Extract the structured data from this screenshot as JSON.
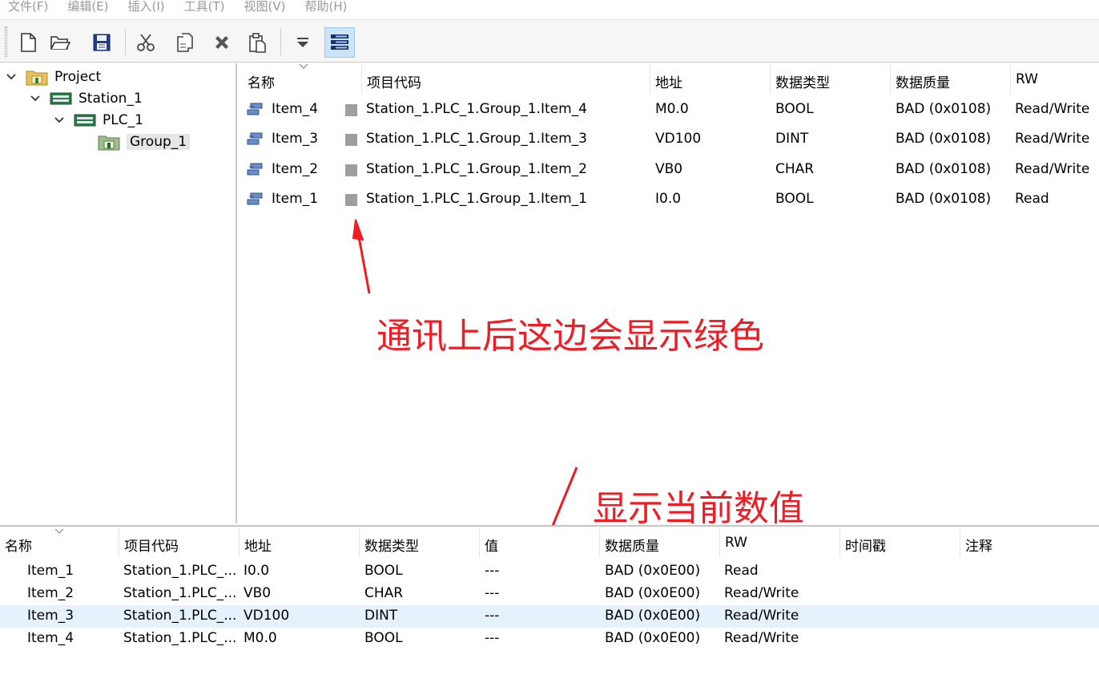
{
  "menu": [
    "文件(F)",
    "编辑(E)",
    "插入(I)",
    "工具(T)",
    "视图(V)",
    "帮助(H)"
  ],
  "toolbar": {
    "buttons": [
      "new-file-icon",
      "open-folder-icon",
      "save-icon",
      "cut-icon",
      "copy-icon",
      "delete-icon",
      "paste-icon",
      "filter-icon",
      "monitor-view-icon"
    ]
  },
  "tree": {
    "project": "Project",
    "station": "Station_1",
    "plc": "PLC_1",
    "group": "Group_1"
  },
  "item_list": {
    "columns": [
      "名称",
      "项目代码",
      "地址",
      "数据类型",
      "数据质量",
      "RW"
    ],
    "rows": [
      {
        "name": "Item_4",
        "code": "Station_1.PLC_1.Group_1.Item_4",
        "address": "M0.0",
        "type": "BOOL",
        "quality": "BAD (0x0108)",
        "rw": "Read/Write"
      },
      {
        "name": "Item_3",
        "code": "Station_1.PLC_1.Group_1.Item_3",
        "address": "VD100",
        "type": "DINT",
        "quality": "BAD (0x0108)",
        "rw": "Read/Write"
      },
      {
        "name": "Item_2",
        "code": "Station_1.PLC_1.Group_1.Item_2",
        "address": "VB0",
        "type": "CHAR",
        "quality": "BAD (0x0108)",
        "rw": "Read/Write"
      },
      {
        "name": "Item_1",
        "code": "Station_1.PLC_1.Group_1.Item_1",
        "address": "I0.0",
        "type": "BOOL",
        "quality": "BAD (0x0108)",
        "rw": "Read"
      }
    ],
    "status_color": "#9e9e9e"
  },
  "annotations": {
    "status_note": "通讯上后这边会显示绿色",
    "value_note": "显示当前数值",
    "color": "#ee1c24"
  },
  "monitor": {
    "columns": [
      "名称",
      "项目代码",
      "地址",
      "数据类型",
      "值",
      "数据质量",
      "RW",
      "时间戳",
      "注释"
    ],
    "rows": [
      {
        "name": "Item_1",
        "code": "Station_1.PLC_...",
        "address": "I0.0",
        "type": "BOOL",
        "value": "---",
        "quality": "BAD (0x0E00)",
        "rw": "Read",
        "timestamp": "",
        "comment": ""
      },
      {
        "name": "Item_2",
        "code": "Station_1.PLC_...",
        "address": "VB0",
        "type": "CHAR",
        "value": "---",
        "quality": "BAD (0x0E00)",
        "rw": "Read/Write",
        "timestamp": "",
        "comment": ""
      },
      {
        "name": "Item_3",
        "code": "Station_1.PLC_...",
        "address": "VD100",
        "type": "DINT",
        "value": "---",
        "quality": "BAD (0x0E00)",
        "rw": "Read/Write",
        "timestamp": "",
        "comment": ""
      },
      {
        "name": "Item_4",
        "code": "Station_1.PLC_...",
        "address": "M0.0",
        "type": "BOOL",
        "value": "---",
        "quality": "BAD (0x0E00)",
        "rw": "Read/Write",
        "timestamp": "",
        "comment": ""
      }
    ],
    "highlight_color": "#e5f1fb"
  }
}
